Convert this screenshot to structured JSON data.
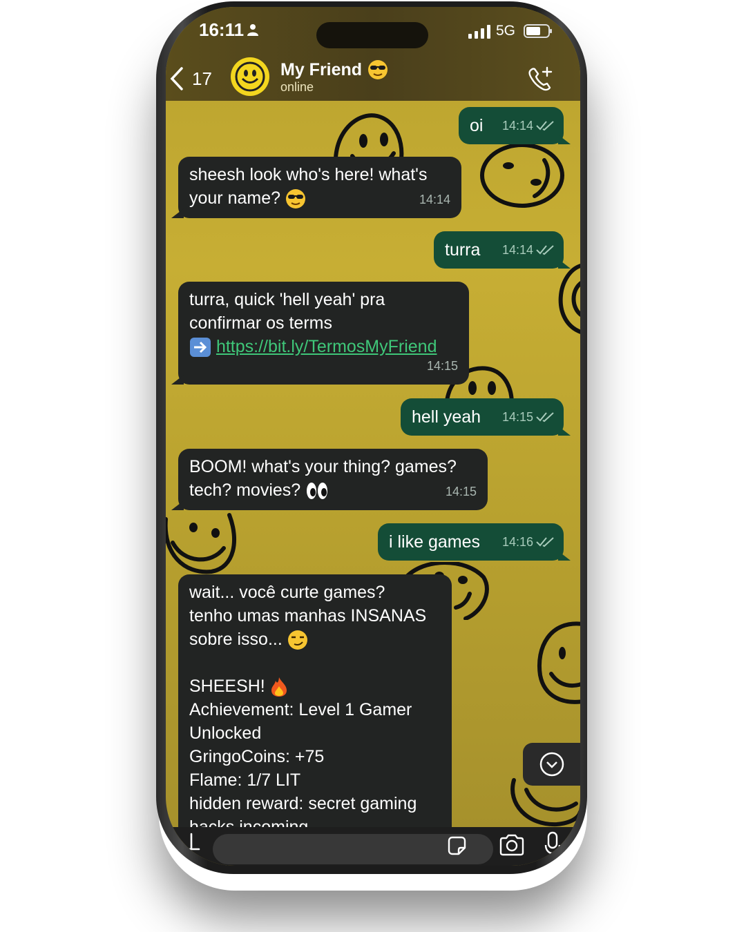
{
  "status_bar": {
    "time": "16:11",
    "network": "5G"
  },
  "header": {
    "back_count": "17",
    "contact_name": "My Friend",
    "contact_status": "online"
  },
  "messages": [
    {
      "dir": "out",
      "lines": [
        "oi"
      ],
      "time": "14:14",
      "read": true
    },
    {
      "dir": "in",
      "lines": [
        "sheesh look who's here! what's",
        "your name?"
      ],
      "time": "14:14"
    },
    {
      "dir": "out",
      "lines": [
        "turra"
      ],
      "time": "14:14",
      "read": true
    },
    {
      "dir": "in",
      "lines": [
        "turra, quick 'hell yeah' pra",
        "confirmar os terms"
      ],
      "link": "https://bit.ly/TermosMyFriend",
      "time": "14:15"
    },
    {
      "dir": "out",
      "lines": [
        "hell yeah"
      ],
      "time": "14:15",
      "read": true
    },
    {
      "dir": "in",
      "lines": [
        "BOOM! what's your thing? games?",
        "tech? movies?"
      ],
      "time": "14:15"
    },
    {
      "dir": "out",
      "lines": [
        "i like games"
      ],
      "time": "14:16",
      "read": true
    },
    {
      "dir": "in",
      "lines": [
        "wait... você curte games?",
        "tenho umas manhas INSANAS",
        "sobre isso...",
        "",
        "SHEESH!",
        "Achievement: Level 1 Gamer",
        "Unlocked",
        "GringoCoins: +75",
        "Flame: 1/7 LIT",
        "hidden reward: secret gaming",
        "hacks incoming"
      ]
    }
  ],
  "icons": {
    "back": "chevron-left-icon",
    "call": "phone-add-icon",
    "scroll": "chevron-down-circle-icon",
    "composer": [
      "plus-icon",
      "sticker-icon",
      "camera-icon",
      "mic-icon"
    ]
  },
  "colors": {
    "wallpaper": "#c2aa33",
    "outgoing_bubble": "#144d37",
    "incoming_bubble": "#222423",
    "link": "#3fc779"
  }
}
